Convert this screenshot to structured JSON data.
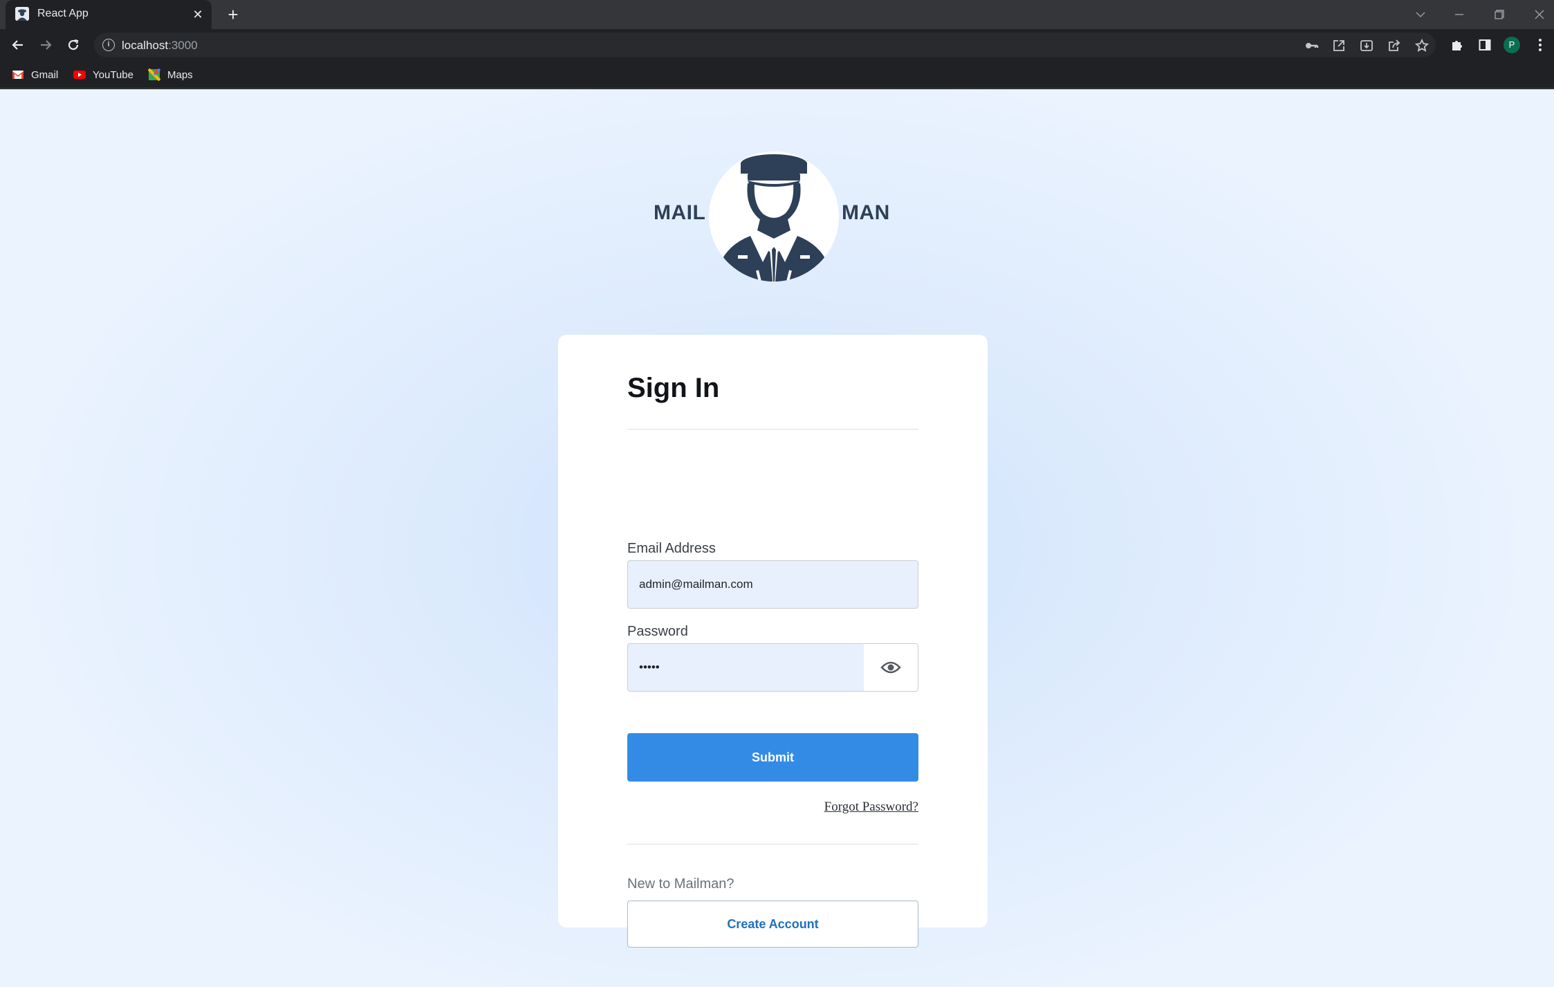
{
  "browser": {
    "tab_title": "React App",
    "tab_close": "✕",
    "new_tab": "+",
    "url_host": "localhost",
    "url_port": ":3000",
    "profile_initial": "P",
    "bookmarks": [
      {
        "label": "Gmail",
        "icon": "gmail-icon",
        "color": "#ea4335"
      },
      {
        "label": "YouTube",
        "icon": "youtube-icon",
        "color": "#ff0000"
      },
      {
        "label": "Maps",
        "icon": "maps-icon",
        "color": "#34a853"
      }
    ]
  },
  "logo": {
    "left_text": "MAIL",
    "right_text": "MAN",
    "color": "#2e3f58"
  },
  "signin": {
    "heading": "Sign In",
    "email_label": "Email Address",
    "email_value": "admin@mailman.com",
    "password_label": "Password",
    "password_value": "admin",
    "submit_label": "Submit",
    "forgot_label": "Forgot Password?",
    "new_prompt": "New to Mailman?",
    "create_label": "Create Account"
  },
  "colors": {
    "primary_button": "#348be6",
    "link": "#1f6fbf",
    "input_fill": "#e8f0fe"
  }
}
